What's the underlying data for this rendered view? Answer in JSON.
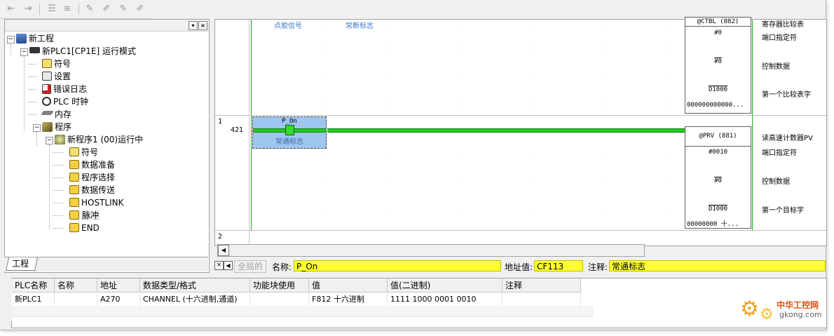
{
  "tree": {
    "items": [
      {
        "label": "新工程",
        "icon": "network-project-icon"
      },
      {
        "label": "新PLC1[CP1E] 运行模式",
        "icon": "plc-device-icon"
      },
      {
        "label": "符号",
        "icon": "symbol-table-icon"
      },
      {
        "label": "设置",
        "icon": "settings-icon"
      },
      {
        "label": "错误日志",
        "icon": "error-log-icon"
      },
      {
        "label": "PLC 时钟",
        "icon": "clock-icon"
      },
      {
        "label": "内存",
        "icon": "memory-chip-icon"
      },
      {
        "label": "程序",
        "icon": "programs-icon"
      },
      {
        "label": "新程序1 (00)运行中",
        "icon": "program-running-icon"
      },
      {
        "label": "符号",
        "icon": "symbol-table-icon"
      },
      {
        "label": "数据准备",
        "icon": "section-icon"
      },
      {
        "label": "程序选择",
        "icon": "section-icon"
      },
      {
        "label": "数据传送",
        "icon": "section-icon"
      },
      {
        "label": "HOSTLINK",
        "icon": "section-icon"
      },
      {
        "label": "脉冲",
        "icon": "section-icon"
      },
      {
        "label": "END",
        "icon": "section-icon"
      }
    ],
    "tab_label": "工程"
  },
  "ladder": {
    "top_comments": [
      "点胶信号",
      "常断标志"
    ],
    "block1": {
      "name": "@CTBL (882)",
      "p1": "#0",
      "p2": "#0",
      "p3": "D1000",
      "p3_val": "000000000000..."
    },
    "block1_comments": [
      "寄存器比较表",
      "端口指定符",
      "控制数据",
      "第一个比较表字"
    ],
    "rung1_number": "1",
    "rung1_step": "421",
    "contact_label": "P_On",
    "contact_comment": "常通标志",
    "block2": {
      "name": "@PRV (881)",
      "p1": "#0010",
      "p2": "#0",
      "p3": "D1000",
      "p3_val": "00000000 十..."
    },
    "block2_comments": [
      "读高速计数器PV",
      "端口指定符",
      "控制数据",
      "第一个目标字"
    ],
    "rung2_number": "2"
  },
  "infobar": {
    "global_label": "全局的",
    "name_label": "名称:",
    "name_value": "P_On",
    "address_label": "地址值:",
    "address_value": "CF113",
    "comment_label": "注释:",
    "comment_value": "常通标志"
  },
  "watch": {
    "columns": [
      "PLC名称",
      "名称",
      "地址",
      "数据类型/格式",
      "功能块使用",
      "值",
      "值(二进制)",
      "注释"
    ],
    "rows": [
      [
        "新PLC1",
        "",
        "A270",
        "CHANNEL (十六进制,通道)",
        "",
        "F812 十六进制",
        "1111 1000 0001 0010",
        ""
      ]
    ]
  },
  "watermark": {
    "cn": "中华工控网",
    "url": "gkong.com"
  },
  "colors": {
    "highlight": "#ffff33",
    "rung_green": "#22cc22",
    "contact_select": "#9fc6ef"
  }
}
